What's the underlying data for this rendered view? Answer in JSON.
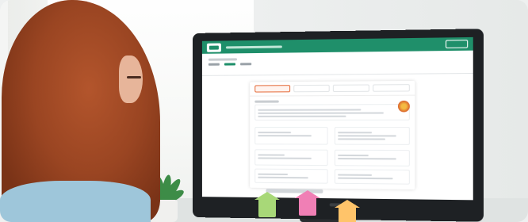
{
  "scene": {
    "subject": "woman-at-computer",
    "colors": {
      "accent": "#1f8f6a",
      "hair": "#9a4522",
      "sweater": "#9ec6da",
      "sticky_green": "#a8d878",
      "sticky_pink": "#f07fb5",
      "sticky_orange": "#ffc46a"
    },
    "icons": [
      "plant-icon",
      "sticky-note-icon",
      "monitor-icon"
    ]
  }
}
